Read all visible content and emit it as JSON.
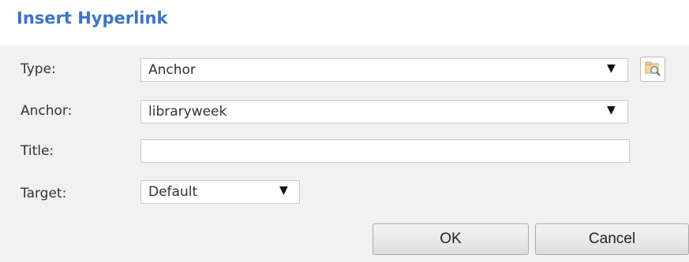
{
  "dialog": {
    "title": "Insert Hyperlink"
  },
  "form": {
    "type": {
      "label": "Type:",
      "value": "Anchor"
    },
    "anchor": {
      "label": "Anchor:",
      "value": "libraryweek"
    },
    "title": {
      "label": "Title:",
      "value": ""
    },
    "target": {
      "label": "Target:",
      "value": "Default"
    },
    "dropdown_glyph": "▼"
  },
  "buttons": {
    "ok": "OK",
    "cancel": "Cancel"
  },
  "icons": {
    "browse": "browse-folder-magnifier-icon"
  },
  "colors": {
    "title": "#3b74c9",
    "form_background": "#f1f1f1"
  }
}
